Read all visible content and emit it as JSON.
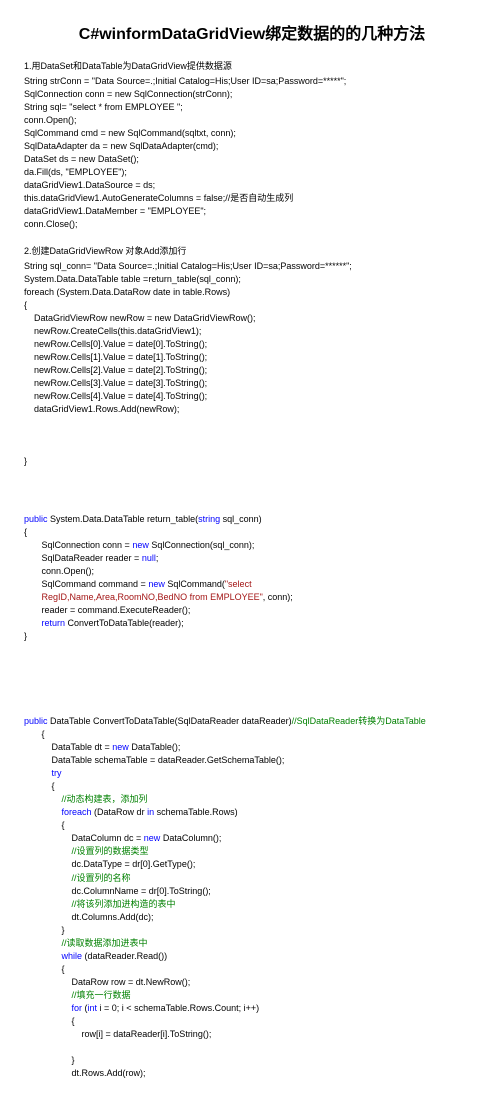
{
  "title": "C#winformDataGridView绑定数据的的几种方法",
  "section1_title": "1.用DataSet和DataTable为DataGridView提供数据源",
  "section2_title": "2.创建DataGridViewRow 对象Add添加行",
  "code1": [
    {
      "t": "String strConn = ",
      "c": "black"
    },
    {
      "t": "\"Data Source=.;Initial Catalog=His;User ID=sa;Password=*****\"",
      "c": "black"
    },
    {
      "t": ";\n",
      "c": "black"
    },
    {
      "t": "SqlConnection conn = ",
      "c": "black"
    },
    {
      "t": "new",
      "c": "black"
    },
    {
      "t": " SqlConnection(strConn);\n",
      "c": "black"
    },
    {
      "t": "String sql= ",
      "c": "black"
    },
    {
      "t": "\"select * from EMPLOYEE \"",
      "c": "black"
    },
    {
      "t": ";\n",
      "c": "black"
    },
    {
      "t": "conn.Open();\n",
      "c": "black"
    },
    {
      "t": "SqlCommand cmd = ",
      "c": "black"
    },
    {
      "t": "new",
      "c": "black"
    },
    {
      "t": " SqlCommand(sqltxt, conn);\n",
      "c": "black"
    },
    {
      "t": "SqlDataAdapter da = ",
      "c": "black"
    },
    {
      "t": "new",
      "c": "black"
    },
    {
      "t": " SqlDataAdapter(cmd);\n",
      "c": "black"
    },
    {
      "t": "DataSet ds = ",
      "c": "black"
    },
    {
      "t": "new",
      "c": "black"
    },
    {
      "t": " DataSet();\n",
      "c": "black"
    },
    {
      "t": "da.Fill(ds, \"EMPLOYEE\");\n",
      "c": "black"
    },
    {
      "t": "dataGridView1.DataSource = ds;\n",
      "c": "black"
    },
    {
      "t": "this.dataGridView1.AutoGenerateColumns = ",
      "c": "black"
    },
    {
      "t": "false",
      "c": "black"
    },
    {
      "t": ";//是否自动生成列\n",
      "c": "black"
    },
    {
      "t": "dataGridView1.DataMember = \"EMPLOYEE\";\n",
      "c": "black"
    },
    {
      "t": "conn.Close();",
      "c": "black"
    }
  ],
  "code2": [
    {
      "t": "String sql_conn= \"Data Source=.;Initial Catalog=His;User ID=sa;Password=******\";\n",
      "c": "black"
    },
    {
      "t": "System.Data.DataTable table =return_table(sql_conn);\n",
      "c": "black"
    },
    {
      "t": "foreach (System.Data.DataRow date in table.Rows)\n",
      "c": "black"
    },
    {
      "t": "{\n",
      "c": "black"
    },
    {
      "t": "    DataGridViewRow newRow = ",
      "c": "black"
    },
    {
      "t": "new ",
      "c": "black"
    },
    {
      "t": "DataGridViewRow();\n",
      "c": "black"
    },
    {
      "t": "    newRow.CreateCells(",
      "c": "black"
    },
    {
      "t": "this",
      "c": "black"
    },
    {
      "t": ".dataGridView1);\n",
      "c": "black"
    },
    {
      "t": "    ",
      "c": "black"
    },
    {
      "t": "newRow.Cells[0].Value = date[0].ToString();\n",
      "c": "black"
    },
    {
      "t": "    ",
      "c": "black"
    },
    {
      "t": "newRow.Cells[1].Value = date[1].ToString();\n",
      "c": "black"
    },
    {
      "t": "    ",
      "c": "black"
    },
    {
      "t": "newRow.Cells[2].Value = date[2].ToString();\n",
      "c": "black"
    },
    {
      "t": "    ",
      "c": "black"
    },
    {
      "t": "newRow.Cells[3].Value = date[3].ToString();\n",
      "c": "black"
    },
    {
      "t": "    ",
      "c": "black"
    },
    {
      "t": "newRow.Cells[4].Value = date[4].ToString();\n",
      "c": "black"
    },
    {
      "t": "    dataGridView1.Rows.Add(newRow);\n",
      "c": "black"
    },
    {
      "t": "\n",
      "c": "black"
    },
    {
      "t": "\n",
      "c": "black"
    },
    {
      "t": "\n",
      "c": "black"
    },
    {
      "t": "}",
      "c": "black"
    }
  ],
  "code3": [
    {
      "t": "public",
      "c": "blue"
    },
    {
      "t": " System.Data.DataTable return_table(",
      "c": "black"
    },
    {
      "t": "string",
      "c": "blue"
    },
    {
      "t": " sql_conn)\n",
      "c": "black"
    },
    {
      "t": "{\n",
      "c": "black"
    },
    {
      "t": "       SqlConnection conn = ",
      "c": "black"
    },
    {
      "t": "new",
      "c": "blue"
    },
    {
      "t": " SqlConnection(sql_conn);\n",
      "c": "black"
    },
    {
      "t": "       SqlDataReader reader = ",
      "c": "black"
    },
    {
      "t": "null",
      "c": "blue"
    },
    {
      "t": ";\n",
      "c": "black"
    },
    {
      "t": "       conn.Open();\n",
      "c": "black"
    },
    {
      "t": "       SqlCommand command = ",
      "c": "black"
    },
    {
      "t": "new",
      "c": "blue"
    },
    {
      "t": " SqlCommand(",
      "c": "black"
    },
    {
      "t": "\"select",
      "c": "red"
    },
    {
      "t": "\n",
      "c": "black"
    },
    {
      "t": "       ",
      "c": "black"
    },
    {
      "t": "RegID,Name,Area,RoomNO,BedNO from EMPLOYEE\"",
      "c": "red"
    },
    {
      "t": ", conn);\n",
      "c": "black"
    },
    {
      "t": "       reader = command.ExecuteReader();\n",
      "c": "black"
    },
    {
      "t": "       ",
      "c": "black"
    },
    {
      "t": "return",
      "c": "blue"
    },
    {
      "t": " ConvertToDataTable(reader);\n",
      "c": "black"
    },
    {
      "t": "}",
      "c": "black"
    }
  ],
  "code4": [
    {
      "t": "public",
      "c": "blue"
    },
    {
      "t": " DataTable ConvertToDataTable(SqlDataReader dataReader)",
      "c": "black"
    },
    {
      "t": "//SqlDataReader转换为DataTable",
      "c": "green"
    },
    {
      "t": "\n",
      "c": "black"
    },
    {
      "t": "       {\n",
      "c": "black"
    },
    {
      "t": "           DataTable dt = ",
      "c": "black"
    },
    {
      "t": "new",
      "c": "blue"
    },
    {
      "t": " DataTable();\n",
      "c": "black"
    },
    {
      "t": "           DataTable schemaTable = dataReader.GetSchemaTable();\n",
      "c": "black"
    },
    {
      "t": "           ",
      "c": "black"
    },
    {
      "t": "try",
      "c": "blue"
    },
    {
      "t": "\n",
      "c": "black"
    },
    {
      "t": "           {\n",
      "c": "black"
    },
    {
      "t": "               ",
      "c": "black"
    },
    {
      "t": "//动态构建表，添加列",
      "c": "green"
    },
    {
      "t": "\n",
      "c": "black"
    },
    {
      "t": "               ",
      "c": "black"
    },
    {
      "t": "foreach",
      "c": "blue"
    },
    {
      "t": " (DataRow dr ",
      "c": "black"
    },
    {
      "t": "in",
      "c": "blue"
    },
    {
      "t": " schemaTable.Rows)\n",
      "c": "black"
    },
    {
      "t": "               {\n",
      "c": "black"
    },
    {
      "t": "                   DataColumn dc = ",
      "c": "black"
    },
    {
      "t": "new",
      "c": "blue"
    },
    {
      "t": " DataColumn();\n",
      "c": "black"
    },
    {
      "t": "                   ",
      "c": "black"
    },
    {
      "t": "//设置列的数据类型",
      "c": "green"
    },
    {
      "t": "\n",
      "c": "black"
    },
    {
      "t": "                   dc.DataType = dr[0].GetType();\n",
      "c": "black"
    },
    {
      "t": "                   ",
      "c": "black"
    },
    {
      "t": "//设置列的名称",
      "c": "green"
    },
    {
      "t": "\n",
      "c": "black"
    },
    {
      "t": "                   dc.ColumnName = dr[0].ToString();\n",
      "c": "black"
    },
    {
      "t": "                   ",
      "c": "black"
    },
    {
      "t": "//将该列添加进构造的表中",
      "c": "green"
    },
    {
      "t": "\n",
      "c": "black"
    },
    {
      "t": "                   dt.Columns.Add(dc);\n",
      "c": "black"
    },
    {
      "t": "               }\n",
      "c": "black"
    },
    {
      "t": "               ",
      "c": "black"
    },
    {
      "t": "//读取数据添加进表中",
      "c": "green"
    },
    {
      "t": "\n",
      "c": "black"
    },
    {
      "t": "               ",
      "c": "black"
    },
    {
      "t": "while",
      "c": "blue"
    },
    {
      "t": " (dataReader.Read())\n",
      "c": "black"
    },
    {
      "t": "               {\n",
      "c": "black"
    },
    {
      "t": "                   DataRow row = dt.NewRow();\n",
      "c": "black"
    },
    {
      "t": "                   ",
      "c": "black"
    },
    {
      "t": "//填充一行数据",
      "c": "green"
    },
    {
      "t": "\n",
      "c": "black"
    },
    {
      "t": "                   ",
      "c": "black"
    },
    {
      "t": "for",
      "c": "blue"
    },
    {
      "t": " (",
      "c": "black"
    },
    {
      "t": "int",
      "c": "blue"
    },
    {
      "t": " i = 0; i < schemaTable.Rows.Count; i++)\n",
      "c": "black"
    },
    {
      "t": "                   {\n",
      "c": "black"
    },
    {
      "t": "                       row[i] = dataReader[i].ToString();\n",
      "c": "black"
    },
    {
      "t": "\n",
      "c": "black"
    },
    {
      "t": "                   }\n",
      "c": "black"
    },
    {
      "t": "                   dt.Rows.Add(row);",
      "c": "black"
    }
  ]
}
